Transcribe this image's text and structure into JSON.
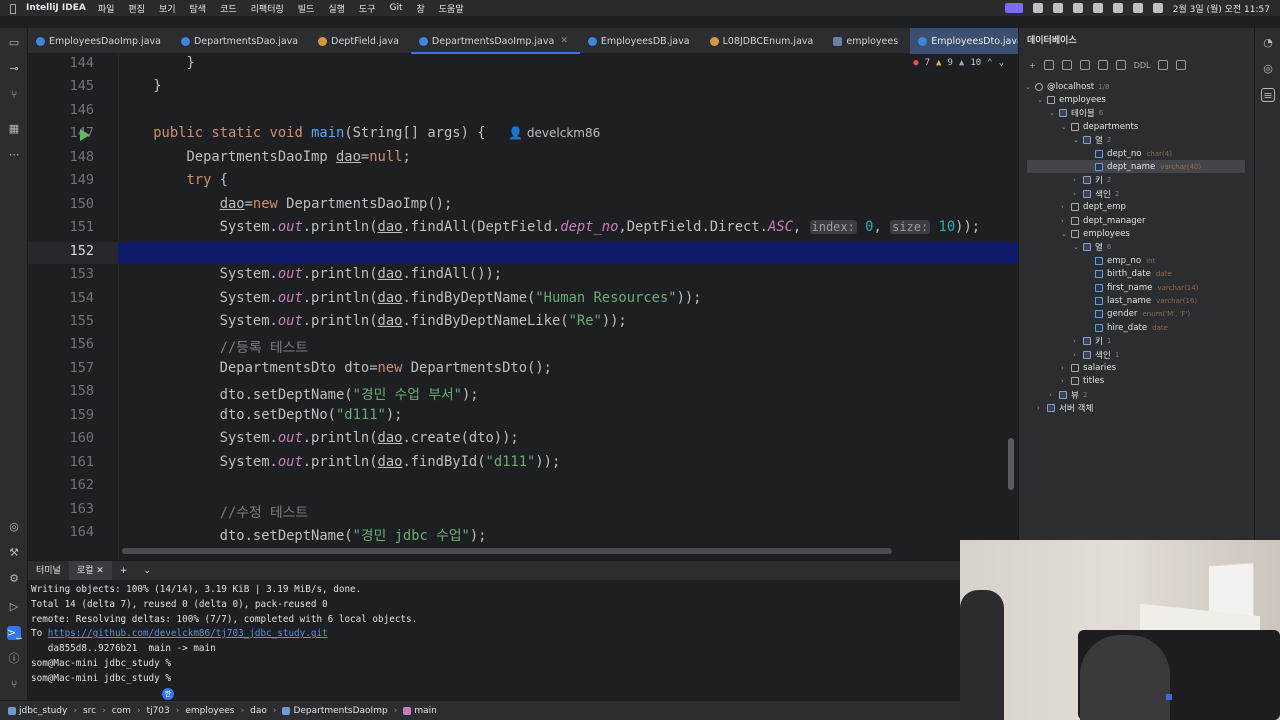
{
  "menubar": {
    "app_name": "IntelliJ IDEA",
    "items": [
      "파일",
      "편집",
      "보기",
      "탐색",
      "코드",
      "리팩터링",
      "빌드",
      "실행",
      "도구",
      "Git",
      "창",
      "도움말"
    ],
    "clock": "2월 3일 (월) 오전 11:57",
    "project_pill": "jdbc_study",
    "branch": "main"
  },
  "tabs": [
    {
      "label": "EmployeesDaoImp.java",
      "icon": "java-class-icon"
    },
    {
      "label": "DepartmentsDao.java",
      "icon": "java-interface-icon"
    },
    {
      "label": "DeptField.java",
      "icon": "java-enum-icon"
    },
    {
      "label": "DepartmentsDaoImp.java",
      "icon": "java-class-icon",
      "active": true
    },
    {
      "label": "EmployeesDB.java",
      "icon": "java-class-icon"
    },
    {
      "label": "L08JDBCEnum.java",
      "icon": "java-enum-icon"
    },
    {
      "label": "employees",
      "icon": "db-table-icon"
    },
    {
      "label": "EmployeesDto.java",
      "icon": "java-class-icon",
      "hover": true
    }
  ],
  "inspection": {
    "errors": "7",
    "warnings": "9",
    "weak": "10"
  },
  "editor": {
    "lines": [
      {
        "num": "144",
        "html": "        }"
      },
      {
        "num": "145",
        "html": "    }"
      },
      {
        "num": "146",
        "html": ""
      },
      {
        "num": "147",
        "html": "    <span class='kw'>public static void</span> <span class='mth'>main</span>(String[] args) {  <span class='author'>👤 develckm86</span>"
      },
      {
        "num": "148",
        "html": "        DepartmentsDaoImp <span class='udl'>dao</span>=<span class='kw'>null</span>;"
      },
      {
        "num": "149",
        "html": "        <span class='kw'>try</span> {"
      },
      {
        "num": "150",
        "html": "            <span class='udl'>dao</span>=<span class='kw'>new</span> DepartmentsDaoImp();"
      },
      {
        "num": "151",
        "html": "            System.<span class='fld'>out</span>.println(<span class='udl'>dao</span>.findAll(DeptField.<span class='fld'>dept_no</span>,DeptField.Direct.<span class='fld'>ASC</span>, <span class='hint'>index:</span> <span class='num'>0</span>, <span class='hint'>size:</span> <span class='num'>10</span>));"
      },
      {
        "num": "152",
        "html": "",
        "current": true
      },
      {
        "num": "153",
        "html": "            System.<span class='fld'>out</span>.println(<span class='udl'>dao</span>.findAll());"
      },
      {
        "num": "154",
        "html": "            System.<span class='fld'>out</span>.println(<span class='udl'>dao</span>.findByDeptName(<span class='str'>\"Human Resources\"</span>));"
      },
      {
        "num": "155",
        "html": "            System.<span class='fld'>out</span>.println(<span class='udl'>dao</span>.findByDeptNameLike(<span class='str'>\"Re\"</span>));"
      },
      {
        "num": "156",
        "html": "            <span class='cmt'>//등록 테스트</span>"
      },
      {
        "num": "157",
        "html": "            DepartmentsDto dto=<span class='kw'>new</span> DepartmentsDto();"
      },
      {
        "num": "158",
        "html": "            dto.setDeptName(<span class='str'>\"경민 수업 부서\"</span>);"
      },
      {
        "num": "159",
        "html": "            dto.setDeptNo(<span class='str'>\"d111\"</span>);"
      },
      {
        "num": "160",
        "html": "            System.<span class='fld'>out</span>.println(<span class='udl'>dao</span>.create(dto));"
      },
      {
        "num": "161",
        "html": "            System.<span class='fld'>out</span>.println(<span class='udl'>dao</span>.findById(<span class='str'>\"d111\"</span>));"
      },
      {
        "num": "162",
        "html": ""
      },
      {
        "num": "163",
        "html": "            <span class='cmt'>//수정 테스트</span>"
      },
      {
        "num": "164",
        "html": "            dto.setDeptName(<span class='str'>\"경민 jdbc 수업\"</span>);"
      }
    ]
  },
  "db_panel": {
    "title": "데이터베이스",
    "toolbar_ddl": "DDL",
    "tree": [
      {
        "label": "@localhost",
        "count": "1/8",
        "level": 0,
        "open": true,
        "icon": "server-icon"
      },
      {
        "label": "employees",
        "level": 1,
        "open": true,
        "icon": "schema-icon"
      },
      {
        "label": "테이블",
        "count": "6",
        "level": 2,
        "open": true,
        "icon": "folder-icon"
      },
      {
        "label": "departments",
        "level": 3,
        "open": true,
        "icon": "table-icon"
      },
      {
        "label": "열",
        "count": "2",
        "level": 4,
        "open": true,
        "icon": "folder-icon"
      },
      {
        "label": "dept_no",
        "type": "char(4)",
        "level": 5,
        "icon": "column-icon"
      },
      {
        "label": "dept_name",
        "type": "varchar(40)",
        "level": 5,
        "icon": "column-icon",
        "selected": true
      },
      {
        "label": "키",
        "count": "2",
        "level": 4,
        "open": false,
        "icon": "folder-icon"
      },
      {
        "label": "색인",
        "count": "2",
        "level": 4,
        "open": false,
        "icon": "folder-icon"
      },
      {
        "label": "dept_emp",
        "level": 3,
        "open": false,
        "icon": "table-icon"
      },
      {
        "label": "dept_manager",
        "level": 3,
        "open": false,
        "icon": "table-icon"
      },
      {
        "label": "employees",
        "level": 3,
        "open": true,
        "icon": "table-icon"
      },
      {
        "label": "열",
        "count": "6",
        "level": 4,
        "open": true,
        "icon": "folder-icon"
      },
      {
        "label": "emp_no",
        "type": "int",
        "level": 5,
        "icon": "column-icon"
      },
      {
        "label": "birth_date",
        "type": "date",
        "level": 5,
        "icon": "column-icon"
      },
      {
        "label": "first_name",
        "type": "varchar(14)",
        "level": 5,
        "icon": "column-icon"
      },
      {
        "label": "last_name",
        "type": "varchar(16)",
        "level": 5,
        "icon": "column-icon"
      },
      {
        "label": "gender",
        "type": "enum('M', 'F')",
        "level": 5,
        "icon": "column-icon"
      },
      {
        "label": "hire_date",
        "type": "date",
        "level": 5,
        "icon": "column-icon"
      },
      {
        "label": "키",
        "count": "1",
        "level": 4,
        "open": false,
        "icon": "folder-icon"
      },
      {
        "label": "색인",
        "count": "1",
        "level": 4,
        "open": false,
        "icon": "folder-icon"
      },
      {
        "label": "salaries",
        "level": 3,
        "open": false,
        "icon": "table-icon"
      },
      {
        "label": "titles",
        "level": 3,
        "open": false,
        "icon": "table-icon"
      },
      {
        "label": "뷰",
        "count": "2",
        "level": 2,
        "open": false,
        "icon": "folder-icon"
      },
      {
        "label": "서버 객체",
        "level": 1,
        "open": false,
        "icon": "folder-icon"
      }
    ]
  },
  "terminal": {
    "tabs": [
      "터미널",
      "로컬"
    ],
    "lines": [
      "Writing objects: 100% (14/14), 3.19 KiB | 3.19 MiB/s, done.",
      "Total 14 (delta 7), reused 0 (delta 0), pack-reused 0",
      "remote: Resolving deltas: 100% (7/7), completed with 6 local objects.",
      "To ",
      "   da855d8..9276b21  main -> main",
      "som@Mac-mini jdbc_study %",
      "som@Mac-mini jdbc_study %"
    ],
    "link": "https://github.com/develckm86/tj703_jdbc_study.git",
    "ime": "한"
  },
  "statusbar": {
    "crumbs": [
      "jdbc_study",
      "src",
      "com",
      "tj703",
      "employees",
      "dao",
      "DepartmentsDaoImp",
      "main"
    ]
  }
}
